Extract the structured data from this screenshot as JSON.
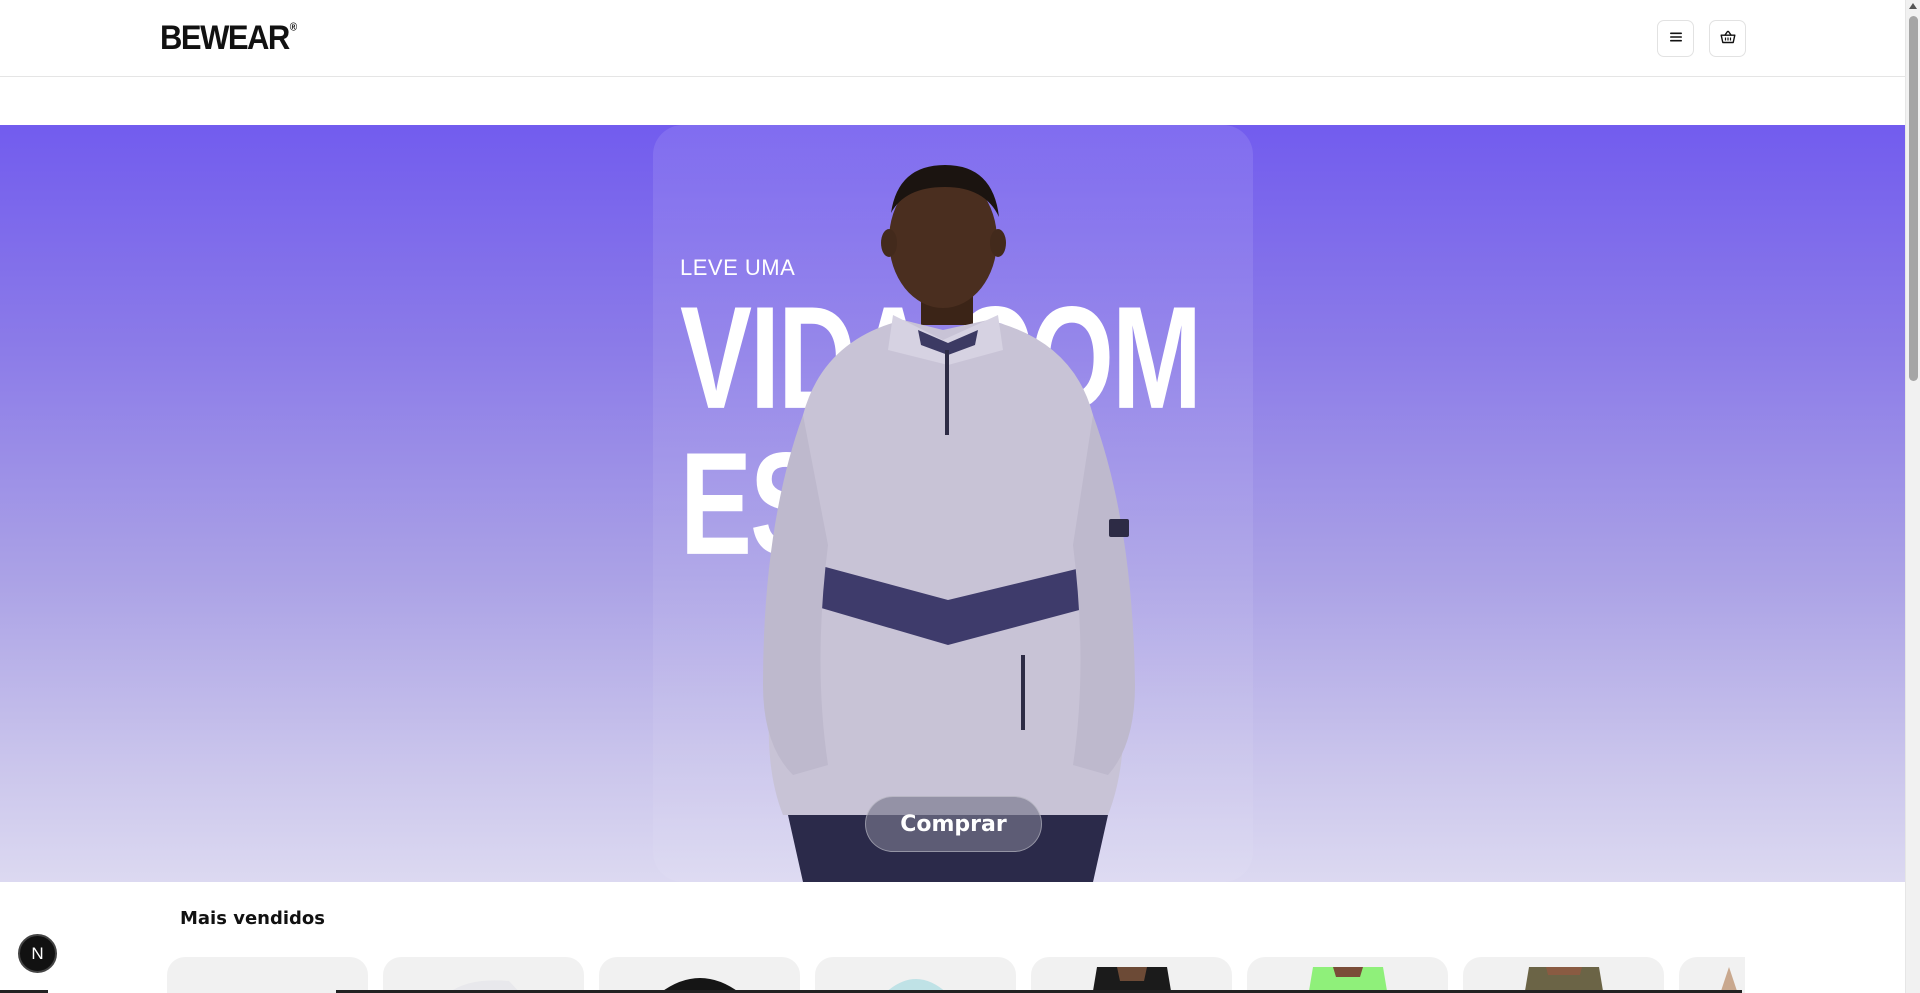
{
  "header": {
    "logo_text": "BEWEAR",
    "logo_mark": "®",
    "menu_icon": "hamburger-icon",
    "cart_icon": "basket-icon"
  },
  "hero": {
    "kicker": "LEVE UMA",
    "line_1": "VIDA COM",
    "line_2": "ESTILO",
    "cta_label": "Comprar",
    "colors": {
      "top": "#725cee",
      "bottom": "#dcd9f1"
    }
  },
  "section": {
    "title": "Mais vendidos"
  },
  "products": [
    {
      "name": "product-1",
      "thumb": "shirt-icon"
    },
    {
      "name": "product-2",
      "thumb": "sneaker-icon"
    },
    {
      "name": "product-3",
      "thumb": "cap-icon"
    },
    {
      "name": "product-4",
      "thumb": "cap-icon"
    },
    {
      "name": "product-5",
      "thumb": "shorts-icon"
    },
    {
      "name": "product-6",
      "thumb": "shorts-icon"
    },
    {
      "name": "product-7",
      "thumb": "shorts-icon"
    },
    {
      "name": "product-8",
      "thumb": "shirt-icon"
    }
  ],
  "next_badge": {
    "label": "N"
  }
}
